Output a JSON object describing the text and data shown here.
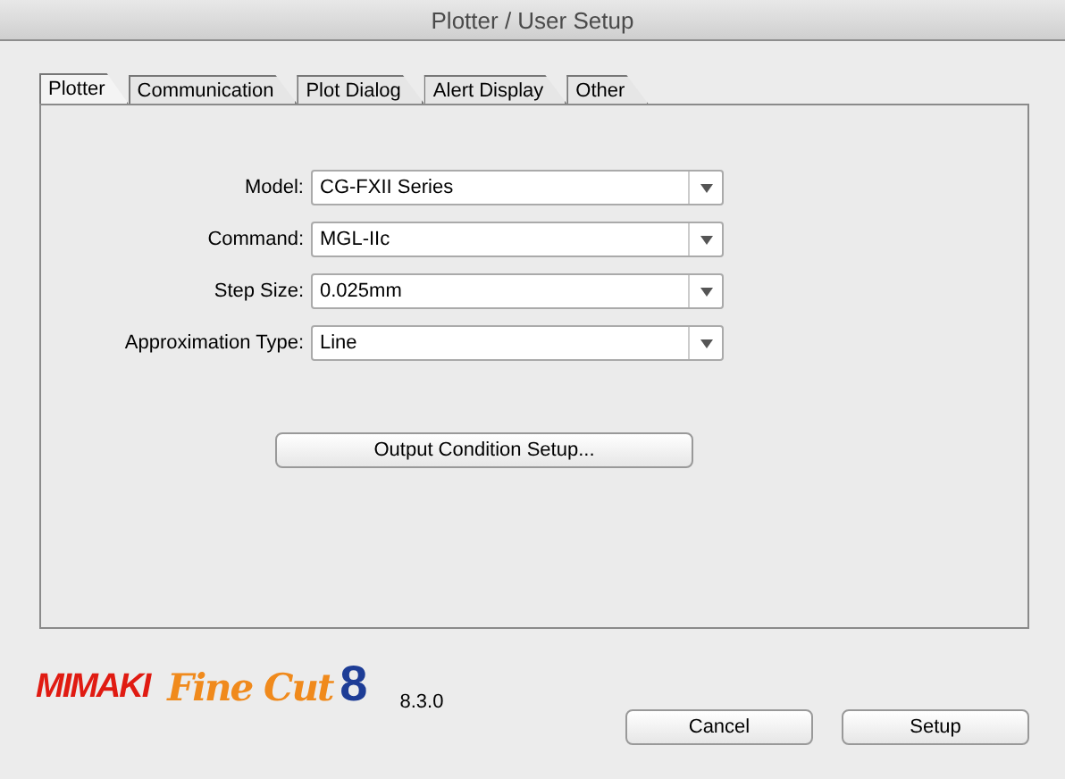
{
  "window": {
    "title": "Plotter / User Setup"
  },
  "tabs": [
    {
      "label": "Plotter",
      "selected": true
    },
    {
      "label": "Communication",
      "selected": false
    },
    {
      "label": "Plot Dialog",
      "selected": false
    },
    {
      "label": "Alert Display",
      "selected": false
    },
    {
      "label": "Other",
      "selected": false
    }
  ],
  "fields": [
    {
      "label": "Model:",
      "value": "CG-FXII Series"
    },
    {
      "label": "Command:",
      "value": "MGL-IIc"
    },
    {
      "label": "Step Size:",
      "value": "0.025mm"
    },
    {
      "label": "Approximation Type:",
      "value": "Line"
    }
  ],
  "panel_button": "Output Condition Setup...",
  "footer": {
    "brand": "MIMAKI",
    "product": "Fine Cut",
    "product_number": "8",
    "version": "8.3.0"
  },
  "buttons": [
    "Cancel",
    "Setup"
  ]
}
